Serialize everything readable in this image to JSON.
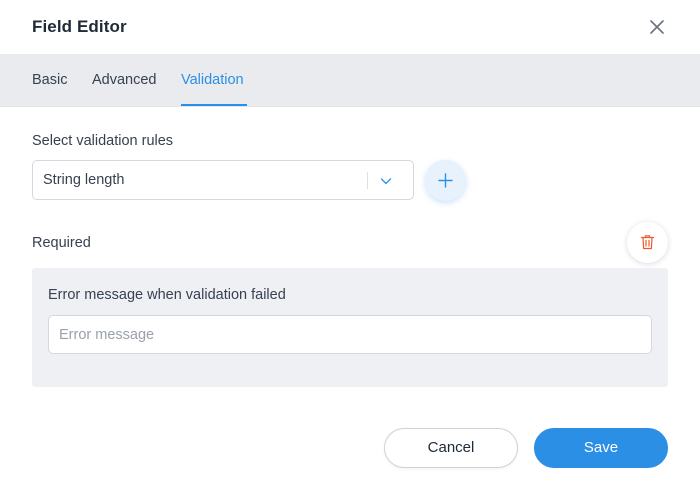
{
  "dialog": {
    "title": "Field Editor"
  },
  "tabs": [
    {
      "label": "Basic",
      "active": false
    },
    {
      "label": "Advanced",
      "active": false
    },
    {
      "label": "Validation",
      "active": true
    }
  ],
  "validation": {
    "rules_label": "Select validation rules",
    "selected_rule": "String length",
    "required_label": "Required",
    "error_panel": {
      "label": "Error message when validation failed",
      "input_value": "",
      "input_placeholder": "Error message"
    }
  },
  "footer": {
    "cancel_label": "Cancel",
    "save_label": "Save"
  },
  "icons": {
    "close": "close-icon",
    "dropdown": "chevron-down-icon",
    "add": "plus-icon",
    "delete": "trash-icon"
  },
  "colors": {
    "accent": "#2b8fe6",
    "danger": "#f05a2b",
    "tab_bar": "#e9ebef",
    "panel": "#eef0f4"
  }
}
